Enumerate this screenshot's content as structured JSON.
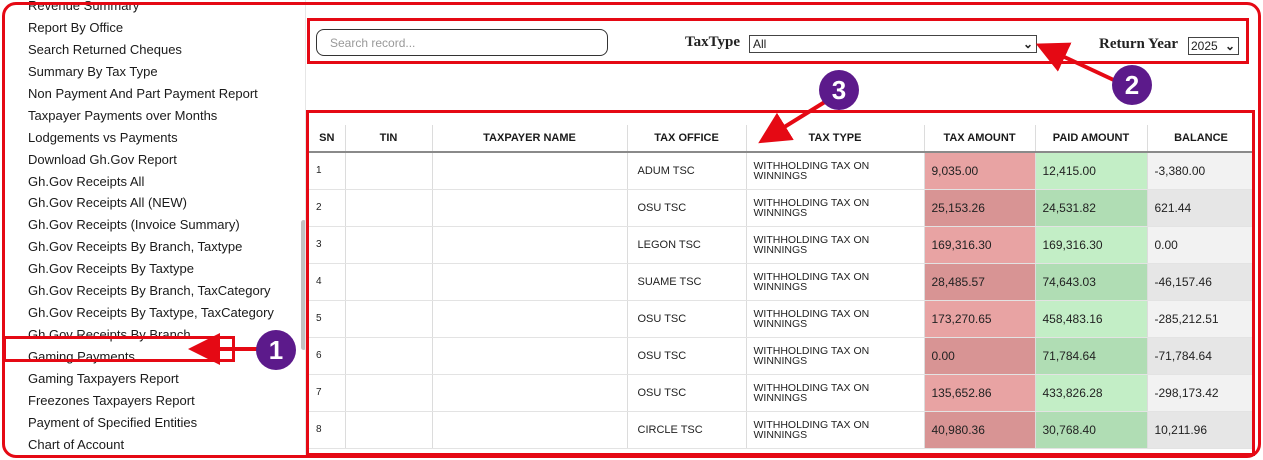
{
  "sidebar": {
    "items": [
      "Revenue Summary",
      "Report By Office",
      "Search Returned Cheques",
      "Summary By Tax Type",
      "Non Payment And Part Payment Report",
      "Taxpayer Payments over Months",
      "Lodgements vs Payments",
      "Download Gh.Gov Report",
      "Gh.Gov Receipts All",
      "Gh.Gov Receipts All (NEW)",
      "Gh.Gov Receipts (Invoice Summary)",
      "Gh.Gov Receipts By Branch, Taxtype",
      "Gh.Gov Receipts By Taxtype",
      "Gh.Gov Receipts By Branch, TaxCategory",
      "Gh.Gov Receipts By Taxtype, TaxCategory",
      "Gh.Gov Receipts By Branch",
      "Gaming Payments",
      "Gaming Taxpayers Report",
      "Freezones Taxpayers Report",
      "Payment of Specified Entities",
      "Chart of Account"
    ]
  },
  "filters": {
    "search_placeholder": "Search record...",
    "taxtype_label": "TaxType",
    "taxtype_value": "All",
    "return_year_label": "Return Year",
    "return_year_value": "2025"
  },
  "table": {
    "headers": [
      "SN",
      "TIN",
      "TAXPAYER NAME",
      "TAX OFFICE",
      "TAX TYPE",
      "TAX AMOUNT",
      "PAID AMOUNT",
      "BALANCE"
    ],
    "rows": [
      {
        "sn": "1",
        "tin": "",
        "name": "",
        "office": "ADUM TSC",
        "type": "WITHHOLDING TAX ON WINNINGS",
        "tax": "9,035.00",
        "paid": "12,415.00",
        "balance": "-3,380.00"
      },
      {
        "sn": "2",
        "tin": "",
        "name": "",
        "office": "OSU TSC",
        "type": "WITHHOLDING TAX ON WINNINGS",
        "tax": "25,153.26",
        "paid": "24,531.82",
        "balance": "621.44"
      },
      {
        "sn": "3",
        "tin": "",
        "name": "",
        "office": "LEGON TSC",
        "type": "WITHHOLDING TAX ON WINNINGS",
        "tax": "169,316.30",
        "paid": "169,316.30",
        "balance": "0.00"
      },
      {
        "sn": "4",
        "tin": "",
        "name": "",
        "office": "SUAME TSC",
        "type": "WITHHOLDING TAX ON WINNINGS",
        "tax": "28,485.57",
        "paid": "74,643.03",
        "balance": "-46,157.46"
      },
      {
        "sn": "5",
        "tin": "",
        "name": "",
        "office": "OSU TSC",
        "type": "WITHHOLDING TAX ON WINNINGS",
        "tax": "173,270.65",
        "paid": "458,483.16",
        "balance": "-285,212.51"
      },
      {
        "sn": "6",
        "tin": "",
        "name": "",
        "office": "OSU TSC",
        "type": "WITHHOLDING TAX ON WINNINGS",
        "tax": "0.00",
        "paid": "71,784.64",
        "balance": "-71,784.64"
      },
      {
        "sn": "7",
        "tin": "",
        "name": "",
        "office": "OSU TSC",
        "type": "WITHHOLDING TAX ON WINNINGS",
        "tax": "135,652.86",
        "paid": "433,826.28",
        "balance": "-298,173.42"
      },
      {
        "sn": "8",
        "tin": "",
        "name": "",
        "office": "CIRCLE TSC",
        "type": "WITHHOLDING TAX ON WINNINGS",
        "tax": "40,980.36",
        "paid": "30,768.40",
        "balance": "10,211.96"
      }
    ]
  },
  "callouts": {
    "one": "1",
    "two": "2",
    "three": "3"
  },
  "colors": {
    "annotation_red": "#e50914",
    "callout_purple": "#5c1a8b",
    "tax_amount_bg": "#e8a3a3",
    "paid_amount_bg": "#c3eec6",
    "balance_bg": "#f2f2f2"
  }
}
